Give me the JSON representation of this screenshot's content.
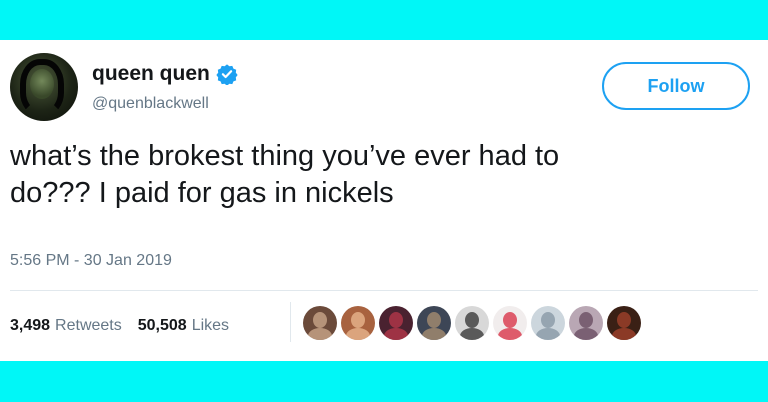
{
  "colors": {
    "band": "#00f7f7",
    "accent": "#1da1f2",
    "text": "#14171a",
    "muted": "#657786"
  },
  "profile": {
    "avatar_icon": "user-avatar-icon",
    "display_name": "queen quen",
    "verified_icon": "verified-badge-icon",
    "handle": "@quenblackwell"
  },
  "follow_button": {
    "label": "Follow"
  },
  "tweet": {
    "text_line1": "what’s the brokest thing you’ve ever had to",
    "text_line2": "do??? I paid for gas in nickels",
    "timestamp": "5:56 PM - 30 Jan 2019"
  },
  "stats": {
    "retweets_count": "3,498",
    "retweets_label": "Retweets",
    "likes_count": "50,508",
    "likes_label": "Likes"
  },
  "likers": [
    {
      "icon": "user-avatar-icon",
      "bg": "#6b4a3a",
      "fg": "#c9a58a"
    },
    {
      "icon": "user-avatar-icon",
      "bg": "#a8623f",
      "fg": "#e7b58d"
    },
    {
      "icon": "user-avatar-icon",
      "bg": "#4a2230",
      "fg": "#b3374a"
    },
    {
      "icon": "user-avatar-icon",
      "bg": "#3d4656",
      "fg": "#a58c70"
    },
    {
      "icon": "user-avatar-icon",
      "bg": "#d8d8d8",
      "fg": "#3b3b3b"
    },
    {
      "icon": "user-avatar-icon",
      "bg": "#f1eded",
      "fg": "#d9364a"
    },
    {
      "icon": "default-avatar-icon",
      "bg": "#ccd6dd",
      "fg": "#8899a6"
    },
    {
      "icon": "user-avatar-icon",
      "bg": "#b9a7b4",
      "fg": "#6a4f63"
    },
    {
      "icon": "user-avatar-icon",
      "bg": "#3a2015",
      "fg": "#a0412b"
    }
  ]
}
